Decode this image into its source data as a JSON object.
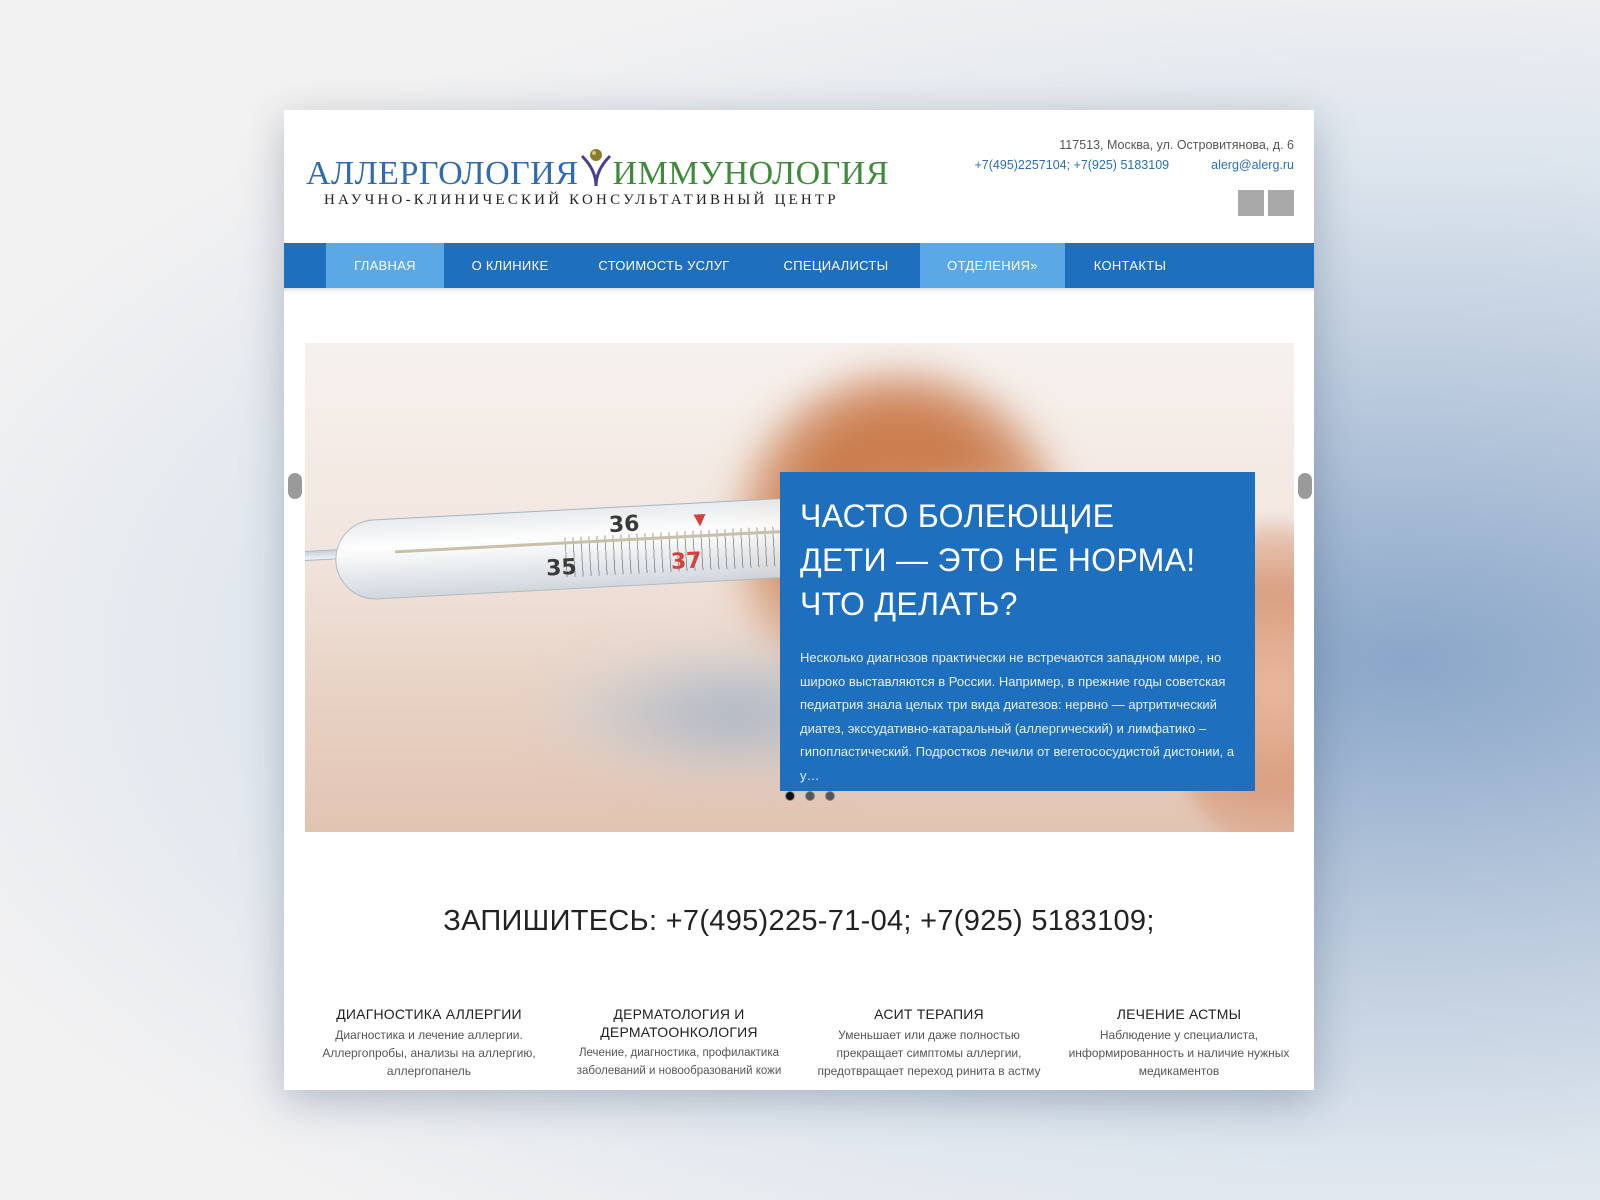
{
  "header": {
    "logo_left": "АЛЛЕРГОЛОГИЯ",
    "logo_right": "ИММУНОЛОГИЯ",
    "logo_sub": "НАУЧНО-КЛИНИЧЕСКИЙ КОНСУЛЬТАТИВНЫЙ ЦЕНТР",
    "address": "117513, Москва, ул. Островитянова, д. 6",
    "phones": "+7(495)2257104; +7(925) 5183109",
    "email": "alerg@alerg.ru"
  },
  "nav": {
    "items": [
      {
        "label": "ГЛАВНАЯ",
        "active": true
      },
      {
        "label": "О КЛИНИКЕ",
        "active": false
      },
      {
        "label": "СТОИМОСТЬ УСЛУГ",
        "active": false
      },
      {
        "label": "СПЕЦИАЛИСТЫ",
        "active": false
      },
      {
        "label": "ОТДЕЛЕНИЯ»",
        "active": true
      },
      {
        "label": "КОНТАКТЫ",
        "active": false
      }
    ]
  },
  "slider": {
    "title_line1": "ЧАСТО БОЛЕЮЩИЕ",
    "title_line2": "ДЕТИ — ЭТО НЕ НОРМА!",
    "title_line3": "ЧТО ДЕЛАТЬ?",
    "text": "Несколько диагнозов практически не встречаются западном мире, но широко выставляются в России. Например, в прежние годы советская педиатрия знала целых три вида диатезов: нервно — артритический диатез, экссудативно-катаральный (аллергический) и лимфатико – гипопластический. Подростков лечили от вегетососудистой дистонии, а у…",
    "thermo": {
      "n36": "36",
      "n35": "35",
      "n37": "37"
    },
    "active_dot": 1,
    "dot_count": 3
  },
  "cta": "ЗАПИШИТЕСЬ: +7(495)225-71-04; +7(925) 5183109;",
  "services": [
    {
      "title": "ДИАГНОСТИКА АЛЛЕРГИИ",
      "text": "Диагностика и лечение аллергии. Аллергопробы, анализы на аллергию, аллергопанель"
    },
    {
      "title": "ДЕРМАТОЛОГИЯ И ДЕРМАТООНКОЛОГИЯ",
      "text": "Лечение, диагностика, профилактика заболеваний и новообразований кожи"
    },
    {
      "title": "АСИТ ТЕРАПИЯ",
      "text": "Уменьшает или даже полностью прекращает симптомы аллергии, предотвращает переход ринита в астму"
    },
    {
      "title": "ЛЕЧЕНИЕ АСТМЫ",
      "text": "Наблюдение у специалиста, информированность и наличие нужных медикаментов"
    }
  ],
  "colors": {
    "brand_blue": "#1f6fbf",
    "nav_active": "#5aa9e6",
    "logo_blue": "#2f6bb3",
    "logo_green": "#3e8b3a"
  }
}
